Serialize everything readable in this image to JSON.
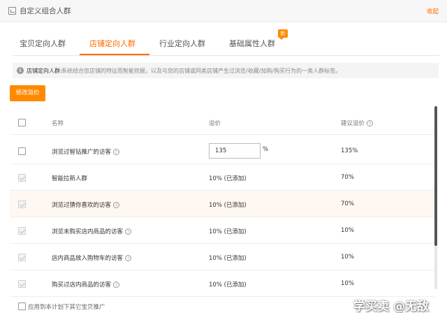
{
  "header": {
    "title": "自定义组合人群",
    "collapse_label": "收起"
  },
  "tabs": [
    {
      "label": "宝贝定向人群"
    },
    {
      "label": "店铺定向人群"
    },
    {
      "label": "行业定向人群"
    },
    {
      "label": "基础属性人群"
    }
  ],
  "tabs_active_index": 1,
  "new_badge": "新",
  "info": {
    "label": "店铺定向人群:",
    "text": "系统结合您店铺的特征而智能挖掘，以及与您的店铺或同类店铺产生过浏览/收藏/加购/购买行为的一类人群标签。"
  },
  "modify_button": "修改溢价",
  "table": {
    "headers": {
      "name": "名称",
      "premium": "溢价",
      "suggested": "建议溢价"
    },
    "rows": [
      {
        "name": "浏览过智钻推广的访客",
        "premium_input": "135",
        "premium_unit": "%",
        "suggested": "135%"
      },
      {
        "name": "智能拉新人群",
        "premium": "10% (已添加)",
        "suggested": "70%"
      },
      {
        "name": "浏览过猜你喜欢的访客",
        "premium": "10% (已添加)",
        "suggested": "70%"
      },
      {
        "name": "浏览未购买店内商品的访客",
        "premium": "10% (已添加)",
        "suggested": "10%"
      },
      {
        "name": "店内商品放入购物车的访客",
        "premium": "10% (已添加)",
        "suggested": "10%"
      },
      {
        "name": "购买过店内商品的访客",
        "premium": "10% (已添加)",
        "suggested": "10%"
      }
    ]
  },
  "footer": {
    "apply_label": "应用到本计划下其它宝贝推广"
  },
  "watermark": "学买卖 @无敌",
  "colors": {
    "accent": "#ff6a00",
    "button": "#ff8a00",
    "highlight_row": "#fff7f2"
  }
}
